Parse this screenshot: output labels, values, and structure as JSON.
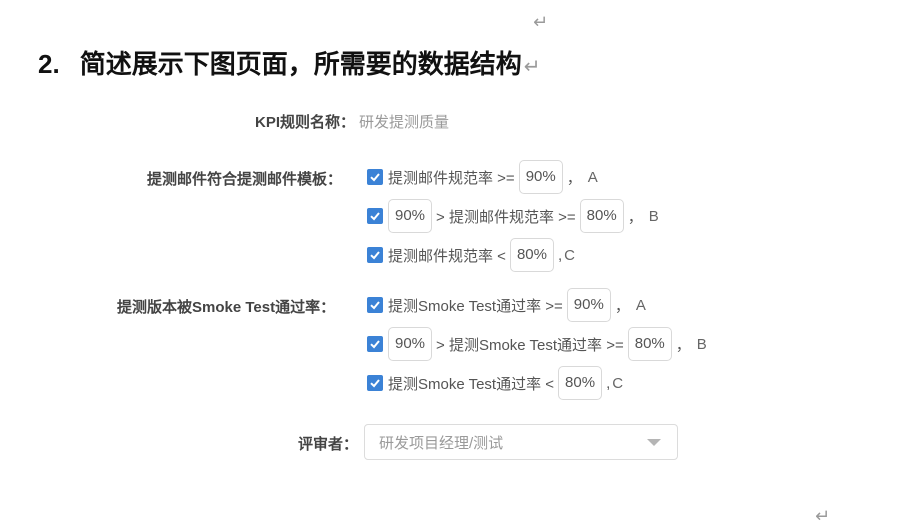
{
  "marks": {
    "para": "↵"
  },
  "heading": {
    "number": "2.",
    "text": "简述展示下图页面，所需要的数据结构"
  },
  "form": {
    "kpi_name": {
      "label": "KPI规则名称：",
      "value": "研发提测质量"
    },
    "mail": {
      "label": "提测邮件符合提测邮件模板：",
      "rules": [
        {
          "checked": true,
          "pre": "提测邮件规范率 >=",
          "v1": "90%",
          "post": "，",
          "grade": "A"
        },
        {
          "checked": true,
          "v1": "90%",
          "mid": "> 提测邮件规范率 >=",
          "v2": "80%",
          "post": "，",
          "grade": "B"
        },
        {
          "checked": true,
          "pre": "提测邮件规范率 <",
          "v1": "80%",
          "post": ",",
          "grade": "C"
        }
      ]
    },
    "smoke": {
      "label": "提测版本被Smoke Test通过率：",
      "rules": [
        {
          "checked": true,
          "pre": "提测Smoke Test通过率 >=",
          "v1": "90%",
          "post": "，",
          "grade": "A"
        },
        {
          "checked": true,
          "v1": "90%",
          "mid": "> 提测Smoke Test通过率 >=",
          "v2": "80%",
          "post": "，",
          "grade": "B"
        },
        {
          "checked": true,
          "pre": "提测Smoke Test通过率 <",
          "v1": "80%",
          "post": ",",
          "grade": "C"
        }
      ]
    },
    "reviewer": {
      "label": "评审者：",
      "value": "研发项目经理/测试"
    }
  },
  "colors": {
    "checkbox": "#3b82d6",
    "heading": "#111111"
  }
}
